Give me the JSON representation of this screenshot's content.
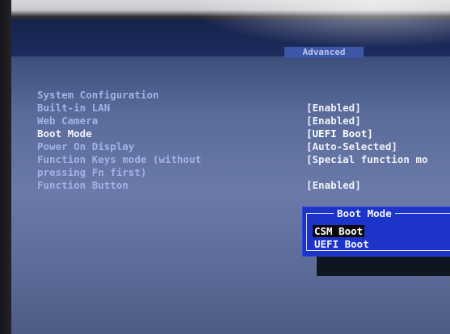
{
  "header": {
    "title": "",
    "active_tab": "Advanced"
  },
  "settings": [
    {
      "label": "System Configuration",
      "value": ""
    },
    {
      "label": "Built-in LAN",
      "value": "[Enabled]"
    },
    {
      "label": "Web Camera",
      "value": "[Enabled]"
    },
    {
      "label": "Boot Mode",
      "value": "[UEFI Boot]"
    },
    {
      "label": "Power On Display",
      "value": "[Auto-Selected]"
    },
    {
      "label": "Function Keys mode (without",
      "value": "[Special function mo"
    },
    {
      "label": "pressing Fn first)",
      "value": ""
    },
    {
      "label": "Function Button",
      "value": "[Enabled]"
    }
  ],
  "popup": {
    "title": "Boot Mode",
    "options": [
      "CSM Boot",
      "UEFI Boot"
    ],
    "highlighted": "CSM Boot"
  },
  "colors": {
    "screen_bg": "#5a6b9a",
    "popup_bg": "#1d34c9",
    "highlight_bg": "#0a0a0a"
  }
}
